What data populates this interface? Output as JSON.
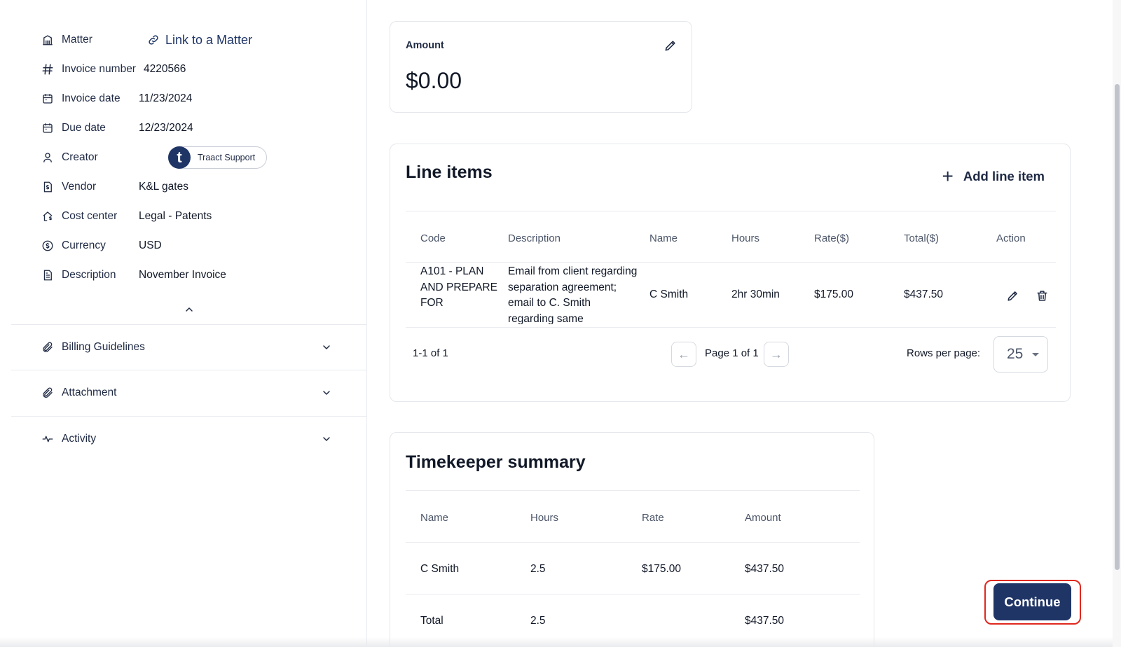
{
  "details": {
    "matter_label": "Matter",
    "link_matter": "Link to a Matter",
    "invoice_number_label": "Invoice number",
    "invoice_number": "4220566",
    "invoice_date_label": "Invoice date",
    "invoice_date": "11/23/2024",
    "due_date_label": "Due date",
    "due_date": "12/23/2024",
    "creator_label": "Creator",
    "creator_initial": "t",
    "creator_name": "Traact Support",
    "vendor_label": "Vendor",
    "vendor": "K&L gates",
    "cost_center_label": "Cost center",
    "cost_center": "Legal - Patents",
    "currency_label": "Currency",
    "currency": "USD",
    "description_label": "Description",
    "description": "November Invoice"
  },
  "sections": {
    "billing_guidelines": "Billing Guidelines",
    "attachment": "Attachment",
    "activity": "Activity"
  },
  "amount": {
    "title": "Amount",
    "value": "$0.00"
  },
  "line_items": {
    "title": "Line items",
    "add_label": "Add line item",
    "columns": [
      "Code",
      "Description",
      "Name",
      "Hours",
      "Rate($)",
      "Total($)",
      "Action"
    ],
    "rows": [
      {
        "code": "A101 - PLAN AND PREPARE FOR",
        "description": "Email from client regarding separation agreement; email to C. Smith regarding same",
        "name": "C Smith",
        "hours": "2hr 30min",
        "rate": "$175.00",
        "total": "$437.50"
      }
    ],
    "range": "1-1 of 1",
    "page_label": "Page 1 of 1",
    "rows_per_page_label": "Rows per page:",
    "rows_per_page": "25"
  },
  "timekeeper": {
    "title": "Timekeeper summary",
    "columns": [
      "Name",
      "Hours",
      "Rate",
      "Amount"
    ],
    "rows": [
      {
        "name": "C Smith",
        "hours": "2.5",
        "rate": "$175.00",
        "amount": "$437.50"
      },
      {
        "name": "Total",
        "hours": "2.5",
        "rate": "",
        "amount": "$437.50"
      }
    ]
  },
  "actions": {
    "continue": "Continue"
  },
  "colors": {
    "primary": "#1f3566",
    "highlight": "#e0281f",
    "border": "#e4e7ec"
  }
}
